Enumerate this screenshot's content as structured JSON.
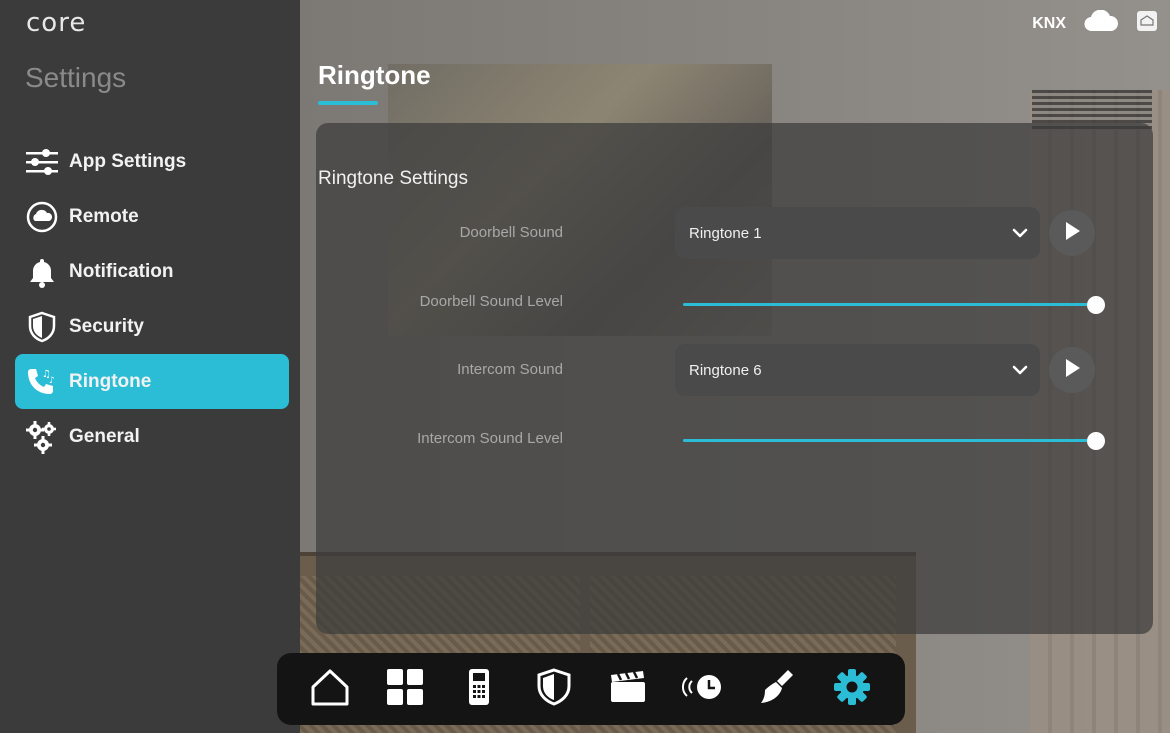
{
  "app": {
    "logo": "core"
  },
  "sidebar": {
    "title": "Settings",
    "items": [
      {
        "label": "App Settings",
        "icon": "sliders-icon",
        "active": false
      },
      {
        "label": "Remote",
        "icon": "cloud-circle-icon",
        "active": false
      },
      {
        "label": "Notification",
        "icon": "bell-icon",
        "active": false
      },
      {
        "label": "Security",
        "icon": "shield-icon",
        "active": false
      },
      {
        "label": "Ringtone",
        "icon": "phone-music-icon",
        "active": true
      },
      {
        "label": "General",
        "icon": "gears-icon",
        "active": false
      }
    ]
  },
  "topbar": {
    "knx_label": "KNX",
    "icons": [
      "cloud-icon",
      "home-badge-icon"
    ]
  },
  "main": {
    "title": "Ringtone",
    "section_title": "Ringtone Settings",
    "doorbell": {
      "sound_label": "Doorbell Sound",
      "sound_value": "Ringtone 1",
      "level_label": "Doorbell Sound Level",
      "level_value": 1.0
    },
    "intercom": {
      "sound_label": "Intercom Sound",
      "sound_value": "Ringtone 6",
      "level_label": "Intercom Sound Level",
      "level_value": 1.0
    }
  },
  "dock": {
    "items": [
      {
        "icon": "home-icon",
        "active": false
      },
      {
        "icon": "grid-icon",
        "active": false
      },
      {
        "icon": "intercom-icon",
        "active": false
      },
      {
        "icon": "shield-icon",
        "active": false
      },
      {
        "icon": "scene-clapper-icon",
        "active": false
      },
      {
        "icon": "schedule-clock-icon",
        "active": false
      },
      {
        "icon": "cleaning-brush-icon",
        "active": false
      },
      {
        "icon": "settings-gear-icon",
        "active": true
      }
    ]
  },
  "colors": {
    "accent": "#2bbdd6",
    "sidebar": "#3b3b3b",
    "panel": "#3c3c3c",
    "dock": "#141414"
  }
}
